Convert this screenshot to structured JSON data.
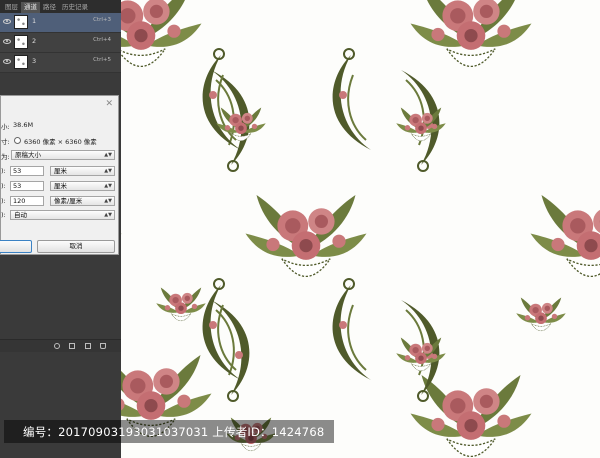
{
  "panel": {
    "tabs": [
      "图层",
      "通道",
      "路径",
      "历史记录"
    ],
    "channels": [
      {
        "name": "1",
        "shortcut": "Ctrl+3",
        "selected": true
      },
      {
        "name": "2",
        "shortcut": "Ctrl+4",
        "selected": false
      },
      {
        "name": "3",
        "shortcut": "Ctrl+5",
        "selected": false
      }
    ]
  },
  "dialog": {
    "size_label": "小:",
    "size_value": "38.6M",
    "dims_label": "寸:",
    "dims_value": "6360 像素 × 6360 像素",
    "fit_label": "为:",
    "fit_value": "原稿大小",
    "width_label": "):",
    "width_value": "53",
    "width_unit": "厘米",
    "height_label": "):",
    "height_value": "53",
    "height_unit": "厘米",
    "res_label": "):",
    "res_value": "120",
    "res_unit": "像素/厘米",
    "resample_label": "):",
    "resample_value": "自动",
    "ok_label": "",
    "cancel_label": "取消"
  },
  "watermark": {
    "text": "编号：20170903193031037031 上传者ID：1424768"
  },
  "colors": {
    "flower": "#c9787a",
    "flower_dark": "#8e4a4e",
    "leaf": "#6b7a3c",
    "leaf_dark": "#4f5a2a",
    "panel": "#3a3a3a",
    "selection": "#4f5f79"
  }
}
